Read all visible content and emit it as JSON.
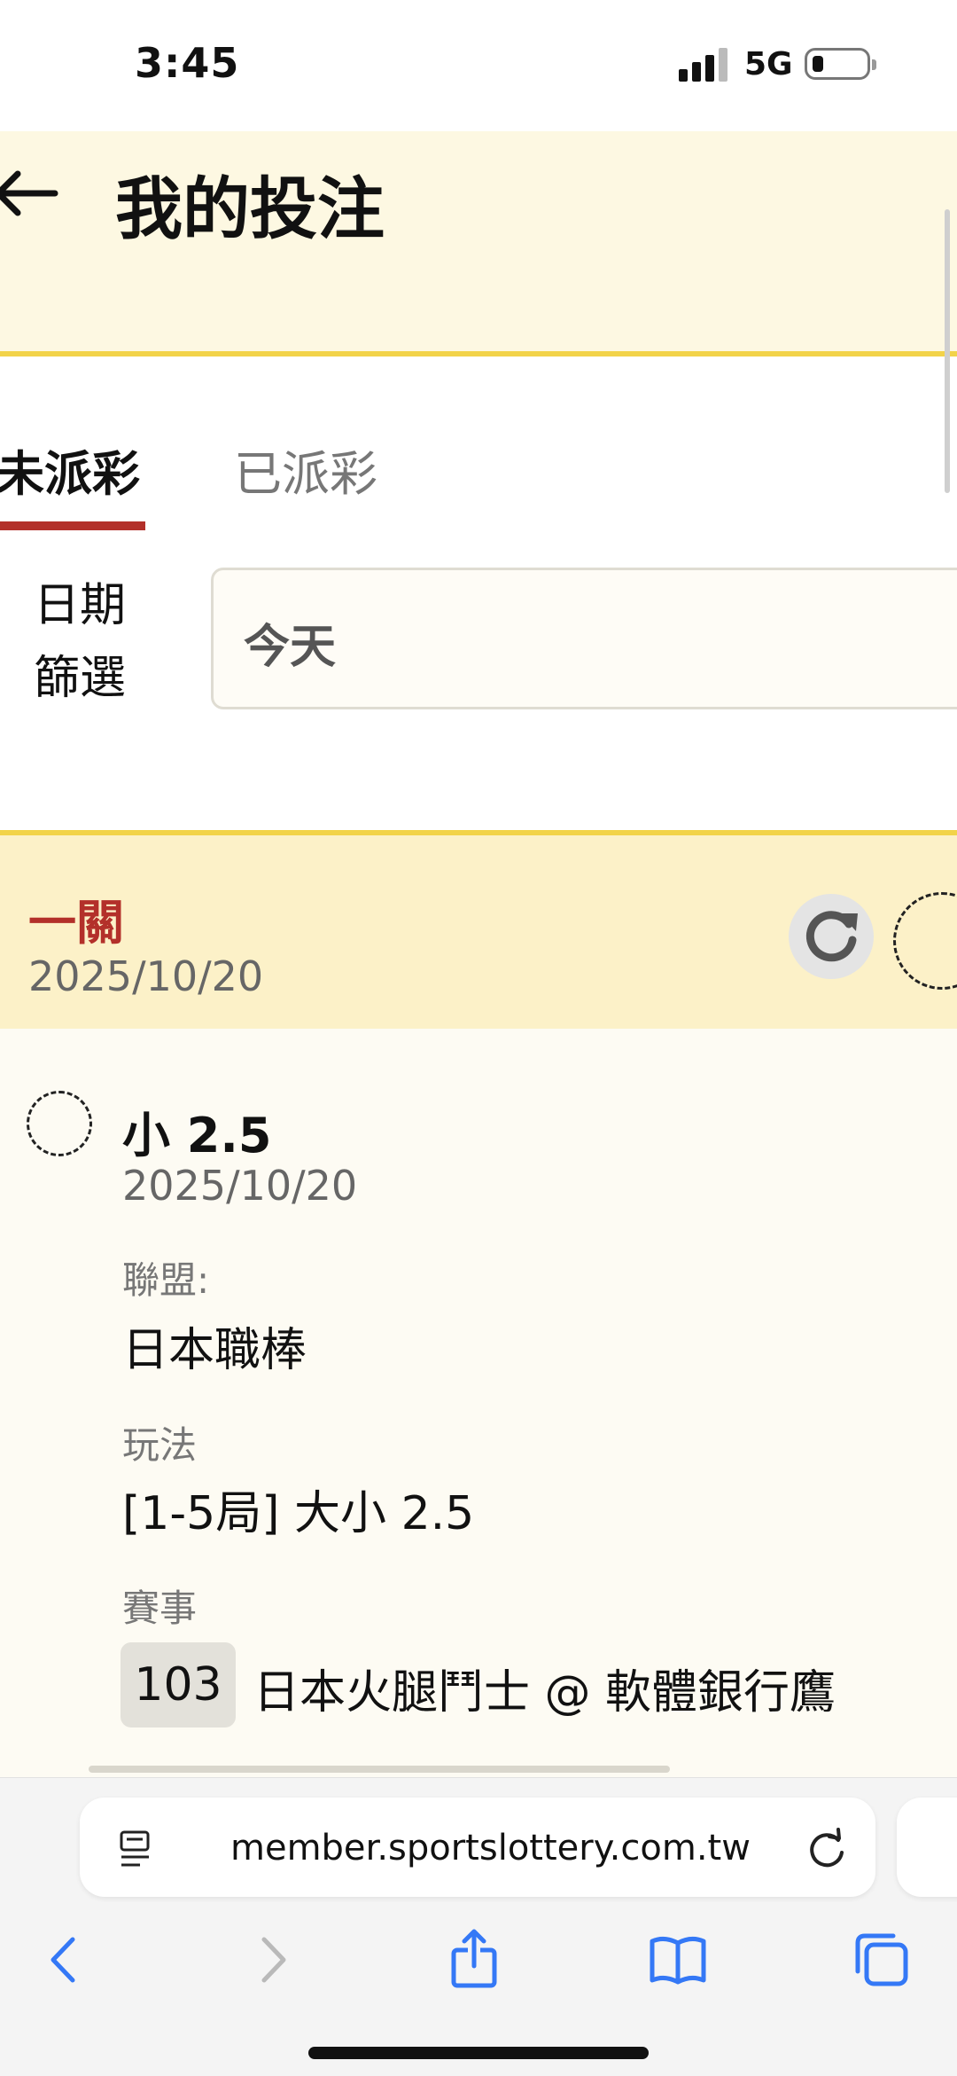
{
  "status_bar": {
    "time": "3:45",
    "network": "5G"
  },
  "header": {
    "title": "我的投注"
  },
  "tabs": [
    {
      "label": "未派彩",
      "active": true
    },
    {
      "label": "已派彩",
      "active": false
    }
  ],
  "filter": {
    "label_line1": "日期",
    "label_line2": "篩選",
    "value": "今天"
  },
  "bet": {
    "type": "一關",
    "date": "2025/10/20",
    "selection": "小 2.5",
    "selection_date": "2025/10/20",
    "league_label": "聯盟:",
    "league": "日本職棒",
    "play_label": "玩法",
    "play": "[1-5局] 大小 2.5",
    "event_label": "賽事",
    "event_no": "103",
    "event_name": "日本火腿鬥士 @ 軟體銀行鷹"
  },
  "browser": {
    "url": "member.sportslottery.com.tw"
  },
  "colors": {
    "accent_red": "#b3302a",
    "accent_yellow": "#f2d349",
    "header_bg": "#fdf8e2",
    "card_bg": "#fcf1c8",
    "ios_blue": "#3478f6"
  },
  "icons": [
    "back-arrow-icon",
    "refresh-icon",
    "reader-icon",
    "reload-icon",
    "back-icon",
    "forward-icon",
    "share-icon",
    "bookmarks-icon",
    "tabs-icon"
  ]
}
